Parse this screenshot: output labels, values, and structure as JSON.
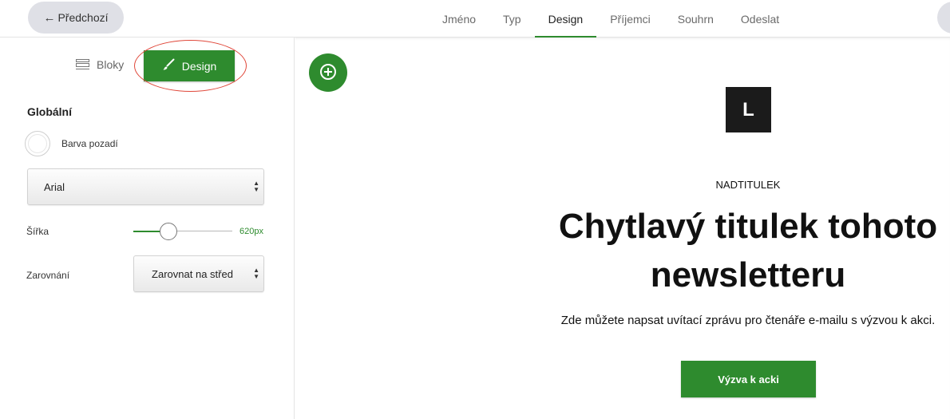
{
  "header": {
    "back_label": "Předchozí",
    "steps": [
      {
        "label": "Jméno",
        "active": false
      },
      {
        "label": "Typ",
        "active": false
      },
      {
        "label": "Design",
        "active": true
      },
      {
        "label": "Příjemci",
        "active": false
      },
      {
        "label": "Souhrn",
        "active": false
      },
      {
        "label": "Odeslat",
        "active": false
      }
    ]
  },
  "sidebar": {
    "tabs": {
      "blocks_label": "Bloky",
      "design_label": "Design",
      "active": "Design"
    },
    "section_title": "Globální",
    "background": {
      "label": "Barva pozadí",
      "color": "#ffffff"
    },
    "font_select": {
      "value": "Arial"
    },
    "width": {
      "label": "Šířka",
      "value_label": "620px",
      "value": 620
    },
    "alignment": {
      "label": "Zarovnání",
      "value": "Zarovnat na střed"
    }
  },
  "preview": {
    "logo_letter": "L",
    "pretitle": "NADTITULEK",
    "headline": "Chytlavý titulek tohoto newsletteru",
    "intro": "Zde můžete napsat uvítací zprávu pro čtenáře e-mailu s výzvou k akci.",
    "cta_label": "Výzva k acki"
  },
  "icons": {
    "back": "arrow-left-icon",
    "blocks": "blocks-icon",
    "design": "paintbrush-icon",
    "add": "plus-circle-icon",
    "select_caret": "updown-caret-icon"
  },
  "colors": {
    "accent": "#2e8b2e",
    "highlight": "#e0483a",
    "logo_bg": "#1b1b1b"
  }
}
